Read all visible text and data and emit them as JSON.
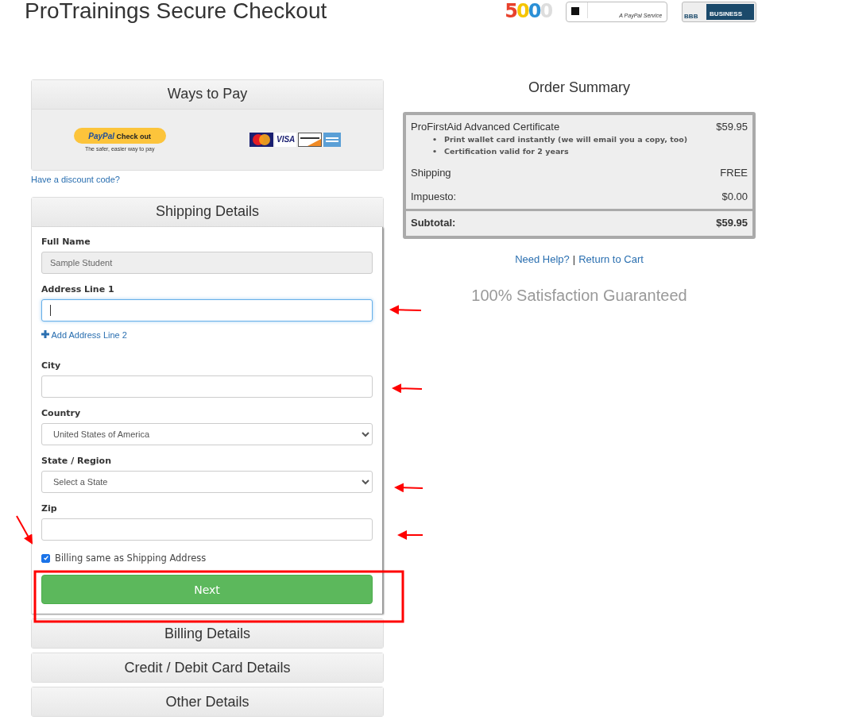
{
  "page_title": "ProTrainings Secure Checkout",
  "logos": {
    "inc_digits": [
      "5",
      "0",
      "0",
      "0"
    ],
    "braintree_tagline": "A PayPal Service",
    "bbb_mark": "BBB",
    "bbb_label": "BUSINESS"
  },
  "ways_to_pay": {
    "title": "Ways to Pay",
    "paypal_brand": "PayPal",
    "paypal_button": "Check out",
    "paypal_tagline": "The safer, easier way to pay",
    "visa_label": "VISA"
  },
  "discount_link": "Have a discount code?",
  "shipping": {
    "title": "Shipping Details",
    "expanded": true,
    "fields": [
      {
        "kind": "text",
        "label": "Full Name",
        "value": "Sample Student",
        "disabled": true,
        "focused": false
      },
      {
        "kind": "text",
        "label": "Address Line 1",
        "disabled": false,
        "focused": true
      },
      {
        "kind": "link",
        "label": "Add Address Line 2"
      },
      {
        "kind": "text",
        "label": "City",
        "disabled": false,
        "focused": false
      },
      {
        "kind": "select",
        "label": "Country",
        "value": "United States of America",
        "disabled": false,
        "focused": false
      },
      {
        "kind": "select",
        "label": "State / Region",
        "value": "Select a State",
        "disabled": false,
        "focused": false
      },
      {
        "kind": "text",
        "label": "Zip",
        "disabled": false,
        "focused": false
      }
    ],
    "billing_same": {
      "label": "Billing same as Shipping Address",
      "checked": true
    },
    "next_button": "Next"
  },
  "other_sections": [
    {
      "title": "Billing Details",
      "expanded": false
    },
    {
      "title": "Credit / Debit Card Details",
      "expanded": false
    },
    {
      "title": "Other Details",
      "expanded": false
    }
  ],
  "order_summary": {
    "title": "Order Summary",
    "item": {
      "name": "ProFirstAid Advanced Certificate",
      "price": "$59.95",
      "bullet": "•",
      "features": [
        "Print wallet card instantly (we will email you a copy, too)",
        "Certification valid for 2 years"
      ]
    },
    "rows": [
      {
        "label": "Shipping",
        "value": "FREE"
      },
      {
        "label": "Impuesto:",
        "value": "$0.00"
      }
    ],
    "subtotal": {
      "label": "Subtotal:",
      "value": "$59.95"
    }
  },
  "help": {
    "need_help": "Need Help?",
    "separator": "|",
    "return": "Return to Cart"
  },
  "guarantee": "100% Satisfaction Guaranteed"
}
